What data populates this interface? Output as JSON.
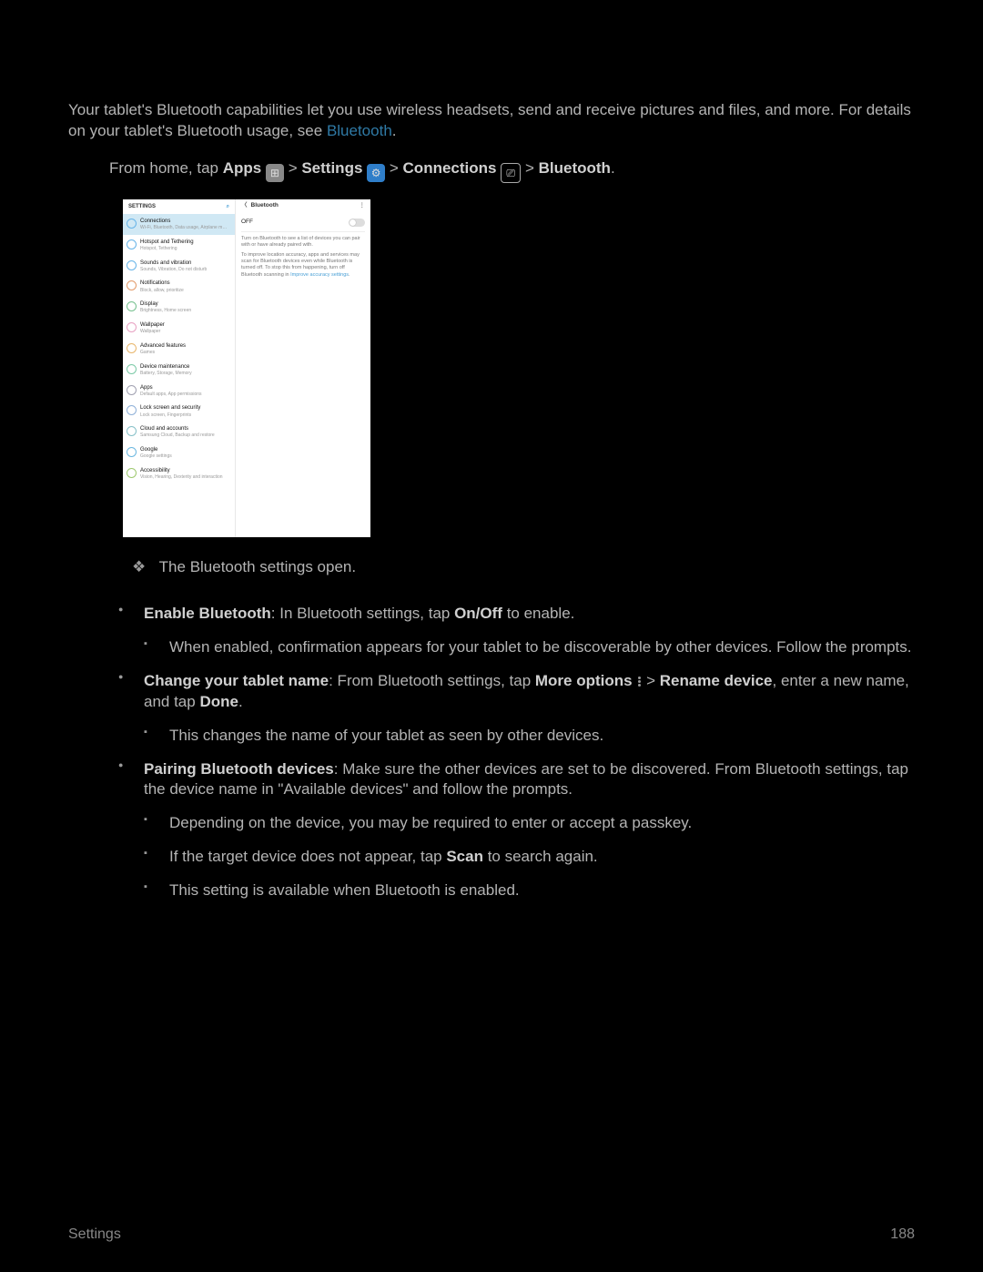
{
  "intro": {
    "text": "Your tablet's Bluetooth capabilities let you use wireless headsets, send and receive pictures and files, and more. For details on your tablet's Bluetooth usage, see ",
    "link": "Bluetooth",
    "tail": "."
  },
  "path": {
    "prefix": "From home, tap ",
    "apps": "Apps",
    "settings": "Settings",
    "connections": "Connections",
    "bluetooth": "Bluetooth",
    "sep": " > "
  },
  "screenshot": {
    "header": "SETTINGS",
    "items": [
      {
        "title": "Connections",
        "sub": "Wi-Fi, Bluetooth, Data usage, Airplane m…",
        "sel": true,
        "color": "#67b4e8"
      },
      {
        "title": "Hotspot and Tethering",
        "sub": "Hotspot, Tethering",
        "color": "#67b4e8"
      },
      {
        "title": "Sounds and vibration",
        "sub": "Sounds, Vibration, Do not disturb",
        "color": "#67b4e8"
      },
      {
        "title": "Notifications",
        "sub": "Block, allow, prioritize",
        "color": "#e39a69"
      },
      {
        "title": "Display",
        "sub": "Brightness, Home screen",
        "color": "#75c08e"
      },
      {
        "title": "Wallpaper",
        "sub": "Wallpaper",
        "color": "#e7a1c2"
      },
      {
        "title": "Advanced features",
        "sub": "Games",
        "color": "#e8b56a"
      },
      {
        "title": "Device maintenance",
        "sub": "Battery, Storage, Memory",
        "color": "#7bc9a6"
      },
      {
        "title": "Apps",
        "sub": "Default apps, App permissions",
        "color": "#a0a0b0"
      },
      {
        "title": "Lock screen and security",
        "sub": "Lock screen, Fingerprints",
        "color": "#8fb0d8"
      },
      {
        "title": "Cloud and accounts",
        "sub": "Samsung Cloud, Backup and restore",
        "color": "#86c0c8"
      },
      {
        "title": "Google",
        "sub": "Google settings",
        "color": "#6bb7e0"
      },
      {
        "title": "Accessibility",
        "sub": "Vision, Hearing, Dexterity and interaction",
        "color": "#9ec96f"
      }
    ],
    "right": {
      "title": "Bluetooth",
      "toggle": "OFF",
      "p1": "Turn on Bluetooth to see a list of devices you can pair with or have already paired with.",
      "p2": "To improve location accuracy, apps and services may scan for Bluetooth devices even while Bluetooth is turned off. To stop this from happening, turn off Bluetooth scanning in ",
      "p2link": "Improve accuracy settings",
      "p2tail": "."
    }
  },
  "diamond": "The Bluetooth settings open.",
  "bullets": [
    {
      "lead": "Enable Bluetooth",
      "text": ": In Bluetooth settings, tap ",
      "bold2": "On/Off",
      "tail": " to enable.",
      "subs": [
        "When enabled, confirmation appears for your tablet to be discoverable by other devices. Follow the prompts."
      ]
    },
    {
      "lead": "Change your tablet name",
      "text": ": From Bluetooth settings, tap ",
      "bold2": "More options",
      "bold3": "Rename device",
      "tail2": ", enter a new name, and tap ",
      "bold4": "Done",
      "tail3": ".",
      "hasMoreIcon": true,
      "subs": [
        "This changes the name of your tablet as seen by other devices."
      ]
    },
    {
      "lead": "Pairing Bluetooth devices",
      "text": ": Make sure the other devices are set to be discovered. From Bluetooth settings, tap the device name in \"Available devices\" and follow the prompts.",
      "subs": [
        "Depending on the device, you may be required to enter or accept a passkey.",
        {
          "pre": "If the target device does not appear, tap ",
          "bold": "Scan",
          "post": " to search again."
        },
        "This setting is available when Bluetooth is enabled."
      ]
    }
  ],
  "footer": {
    "left": "Settings",
    "right": "188"
  }
}
